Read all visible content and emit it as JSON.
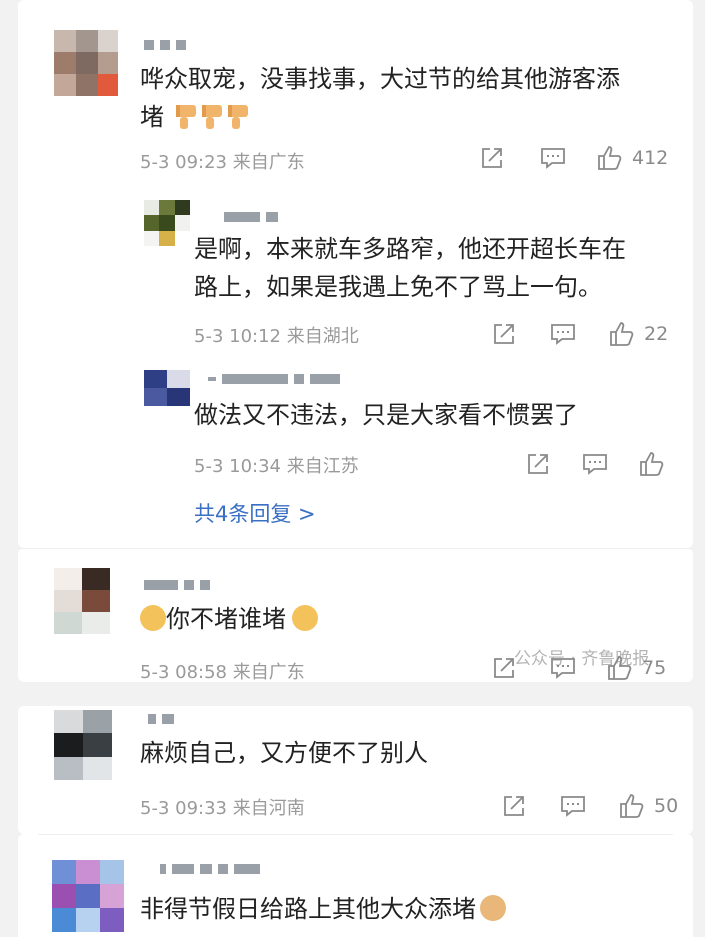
{
  "comments": [
    {
      "text_line1": "哗众取宠，没事找事，大过节的给其他游客添",
      "text_line2": "堵",
      "date": "5-3 09:23",
      "location": "来自广东",
      "likes": "412",
      "emoji_count": 3,
      "replies": [
        {
          "text_line1": "是啊，本来就车多路窄，他还开超长车在",
          "text_line2": "路上，如果是我遇上免不了骂上一句。",
          "date": "5-3 10:12",
          "location": "来自湖北",
          "likes": "22"
        },
        {
          "text": "做法又不违法，只是大家看不惯罢了",
          "date": "5-3 10:34",
          "location": "来自江苏",
          "likes": ""
        }
      ],
      "more_replies": "共4条回复 >"
    },
    {
      "text": "你不堵谁堵",
      "date": "5-3 08:58",
      "location": "来自广东",
      "likes": "75"
    },
    {
      "text": "麻烦自己，又方便不了别人",
      "date": "5-3 09:33",
      "location": "来自河南",
      "likes": "50"
    },
    {
      "text": "非得节假日给路上其他大众添堵"
    }
  ],
  "watermark": "公众号 · 齐鲁晚报",
  "icons": {
    "share": "share-icon",
    "comment": "comment-icon",
    "like": "thumbs-up-icon",
    "dislike_emoji": "thumbs-down-emoji",
    "dog_emoji": "dog-emoji",
    "sweat_emoji": "sweat-emoji",
    "cat_emoji": "cat-emoji"
  },
  "colors": {
    "link": "#3a70c4",
    "meta": "#9a9a9a",
    "text": "#222222",
    "emoji_yellow": "#f3c25a"
  }
}
